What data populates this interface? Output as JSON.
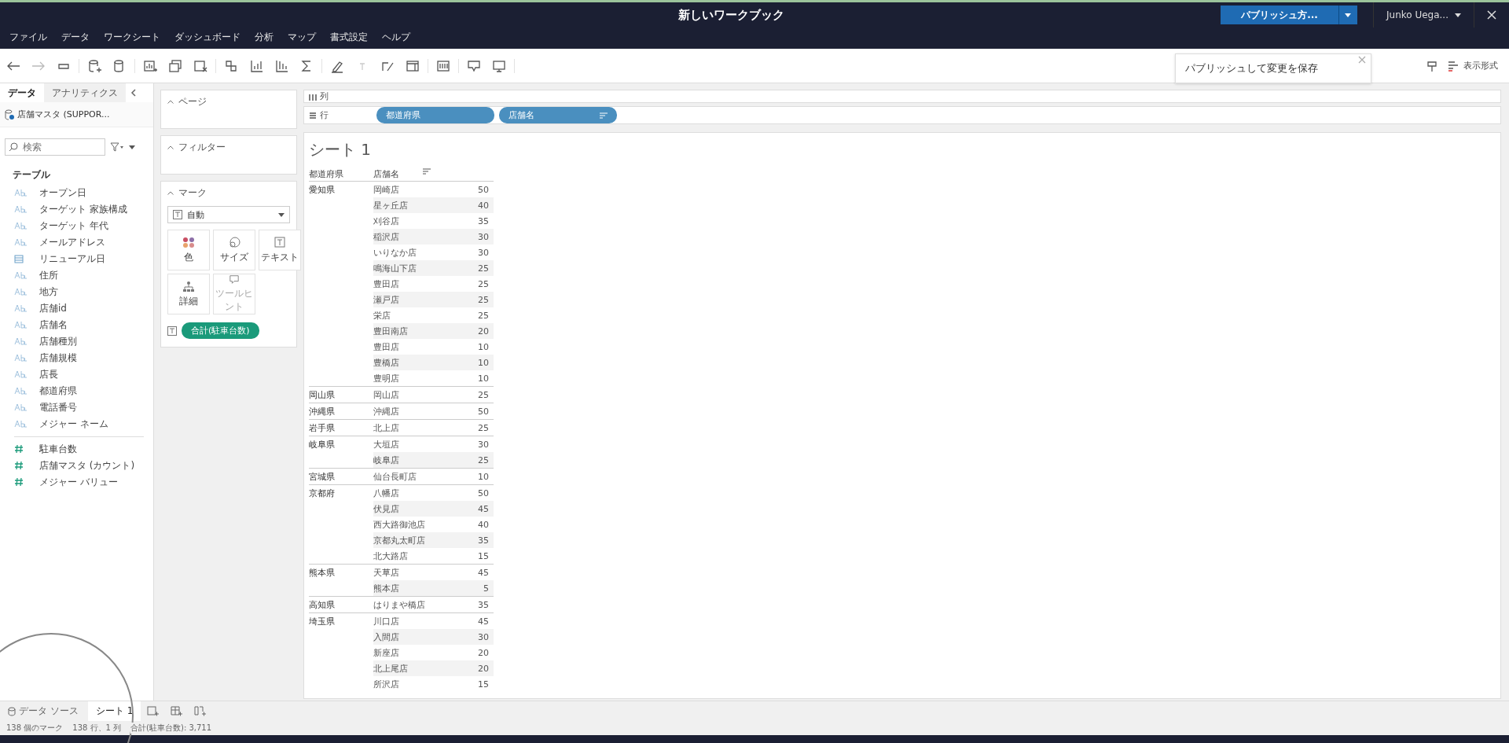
{
  "window": {
    "title": "新しいワークブック"
  },
  "menu": [
    "ファイル",
    "データ",
    "ワークシート",
    "ダッシュボード",
    "分析",
    "マップ",
    "書式設定",
    "ヘルプ"
  ],
  "publish_button": {
    "label": "パブリッシュ方..."
  },
  "user": {
    "name": "Junko Uega..."
  },
  "publish_tip": {
    "text": "パブリッシュして変更を保存"
  },
  "show_me": {
    "label": "表示形式"
  },
  "side_tabs": [
    {
      "label": "データ",
      "selected": true
    },
    {
      "label": "アナリティクス",
      "selected": false
    }
  ],
  "data_source": {
    "name": "店舗マスタ (SUPPOR..."
  },
  "search": {
    "placeholder": "検索"
  },
  "table_heading": "テーブル",
  "fields": [
    {
      "kind": "string",
      "name": "オープン日"
    },
    {
      "kind": "string",
      "name": "ターゲット 家族構成"
    },
    {
      "kind": "string",
      "name": "ターゲット 年代"
    },
    {
      "kind": "string",
      "name": "メールアドレス"
    },
    {
      "kind": "date",
      "name": "リニューアル日"
    },
    {
      "kind": "string",
      "name": "住所"
    },
    {
      "kind": "string",
      "name": "地方"
    },
    {
      "kind": "string",
      "name": "店舗id"
    },
    {
      "kind": "string",
      "name": "店舗名"
    },
    {
      "kind": "string",
      "name": "店舗種別"
    },
    {
      "kind": "string",
      "name": "店舗規模"
    },
    {
      "kind": "string",
      "name": "店長"
    },
    {
      "kind": "string",
      "name": "都道府県"
    },
    {
      "kind": "string",
      "name": "電話番号"
    },
    {
      "kind": "string",
      "name": "メジャー ネーム"
    },
    {
      "kind": "divider"
    },
    {
      "kind": "number",
      "name": "駐車台数"
    },
    {
      "kind": "number",
      "name": "店舗マスタ (カウント)"
    },
    {
      "kind": "number",
      "name": "メジャー バリュー"
    }
  ],
  "cards": {
    "pages": "ページ",
    "filters": "フィルター",
    "marks": "マーク"
  },
  "marks": {
    "type": "自動",
    "buttons": [
      {
        "kind": "color",
        "label": "色",
        "disabled": false
      },
      {
        "kind": "size",
        "label": "サイズ",
        "disabled": false
      },
      {
        "kind": "text",
        "label": "テキスト",
        "disabled": false
      },
      {
        "kind": "detail",
        "label": "詳細",
        "disabled": false
      },
      {
        "kind": "tooltip",
        "label": "ツールヒント",
        "disabled": true
      }
    ],
    "pill": "合計(駐車台数)"
  },
  "shelves": {
    "columns": {
      "label": "列"
    },
    "rows": {
      "label": "行",
      "pills": [
        {
          "label": "都道府県",
          "sorted": false
        },
        {
          "label": "店舗名",
          "sorted": true
        }
      ]
    }
  },
  "sheet": {
    "title": "シート 1",
    "headers": [
      "都道府県",
      "店舗名"
    ],
    "groups": [
      {
        "prefecture": "愛知県",
        "stores": [
          [
            "岡崎店",
            "50"
          ],
          [
            "星ヶ丘店",
            "40"
          ],
          [
            "刈谷店",
            "35"
          ],
          [
            "稲沢店",
            "30"
          ],
          [
            "いりなか店",
            "30"
          ],
          [
            "鳴海山下店",
            "25"
          ],
          [
            "豊田店",
            "25"
          ],
          [
            "瀬戸店",
            "25"
          ],
          [
            "栄店",
            "25"
          ],
          [
            "豊田南店",
            "20"
          ],
          [
            "豊田店",
            "10"
          ],
          [
            "豊橋店",
            "10"
          ],
          [
            "豊明店",
            "10"
          ]
        ]
      },
      {
        "prefecture": "岡山県",
        "stores": [
          [
            "岡山店",
            "25"
          ]
        ]
      },
      {
        "prefecture": "沖縄県",
        "stores": [
          [
            "沖縄店",
            "50"
          ]
        ]
      },
      {
        "prefecture": "岩手県",
        "stores": [
          [
            "北上店",
            "25"
          ]
        ]
      },
      {
        "prefecture": "岐阜県",
        "stores": [
          [
            "大垣店",
            "30"
          ],
          [
            "岐阜店",
            "25"
          ]
        ]
      },
      {
        "prefecture": "宮城県",
        "stores": [
          [
            "仙台長町店",
            "10"
          ]
        ]
      },
      {
        "prefecture": "京都府",
        "stores": [
          [
            "八幡店",
            "50"
          ],
          [
            "伏見店",
            "45"
          ],
          [
            "西大路御池店",
            "40"
          ],
          [
            "京都丸太町店",
            "35"
          ],
          [
            "北大路店",
            "15"
          ]
        ]
      },
      {
        "prefecture": "熊本県",
        "stores": [
          [
            "天草店",
            "45"
          ],
          [
            "熊本店",
            "5"
          ]
        ]
      },
      {
        "prefecture": "高知県",
        "stores": [
          [
            "はりまや橋店",
            "35"
          ]
        ]
      },
      {
        "prefecture": "埼玉県",
        "stores": [
          [
            "川口店",
            "45"
          ],
          [
            "入間店",
            "30"
          ],
          [
            "新座店",
            "20"
          ],
          [
            "北上尾店",
            "20"
          ],
          [
            "所沢店",
            "15"
          ]
        ]
      }
    ]
  },
  "bottom_tabs": [
    {
      "label": "データ ソース",
      "kind": "datasource",
      "selected": false
    },
    {
      "label": "シート 1",
      "kind": "sheet",
      "selected": true
    }
  ],
  "status_bar": [
    "138 個のマーク",
    "138 行、1 列",
    "合計(駐車台数): 3,711"
  ]
}
